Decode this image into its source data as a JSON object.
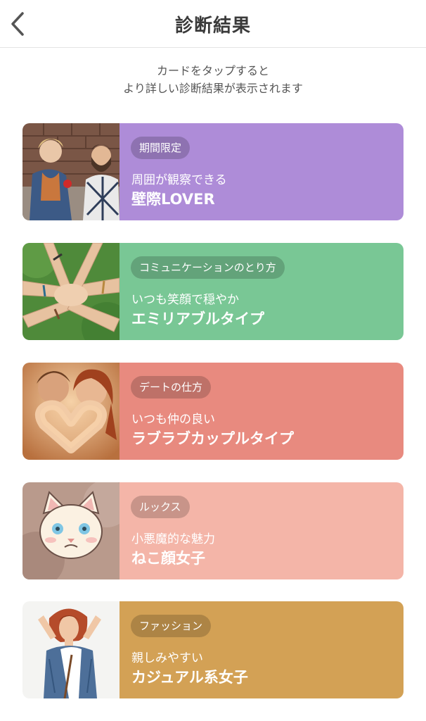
{
  "header": {
    "title": "診断結果",
    "back_icon": "chevron-left-icon"
  },
  "instruction": {
    "line1": "カードをタップすると",
    "line2": "より詳しい診断結果が表示されます"
  },
  "cards": [
    {
      "badge": "期間限定",
      "subtitle": "周囲が観察できる",
      "title": "壁際LOVER",
      "color": "#ae8cd8",
      "photo": "couple-at-brick-wall-photo"
    },
    {
      "badge": "コミュニケーションのとり方",
      "subtitle": "いつも笑顔で穏やか",
      "title": "エミリアブルタイプ",
      "color": "#79c795",
      "photo": "stacked-hands-photo"
    },
    {
      "badge": "デートの仕方",
      "subtitle": "いつも仲の良い",
      "title": "ラブラブカップルタイプ",
      "color": "#e88a7f",
      "photo": "couple-heart-hands-photo"
    },
    {
      "badge": "ルックス",
      "subtitle": "小悪魔的な魅力",
      "title": "ねこ顔女子",
      "color": "#f4b5a8",
      "photo": "white-cat-face-photo"
    },
    {
      "badge": "ファッション",
      "subtitle": "親しみやすい",
      "title": "カジュアル系女子",
      "color": "#d3a155",
      "photo": "casual-fashion-woman-photo"
    }
  ]
}
